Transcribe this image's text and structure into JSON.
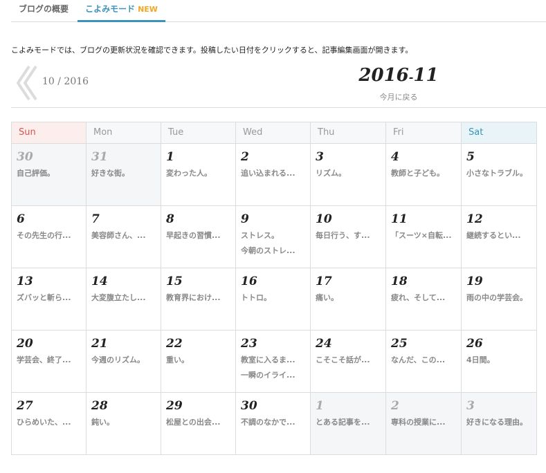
{
  "tabs": {
    "overview": "ブログの概要",
    "calendar": "こよみモード",
    "calendar_badge": "NEW"
  },
  "description": "こよみモードでは、ブログの更新状況を確認できます。投稿したい日付をクリックすると、記事編集画面が開きます。",
  "nav": {
    "prev_label": "10 / 2016",
    "current_year": "2016",
    "current_sep": "-",
    "current_month": "11",
    "back_label": "今月に戻る"
  },
  "weekdays": [
    "Sun",
    "Mon",
    "Tue",
    "Wed",
    "Thu",
    "Fri",
    "Sat"
  ],
  "weeks": [
    [
      {
        "day": "30",
        "other": true,
        "posts": [
          "自己評価。"
        ]
      },
      {
        "day": "31",
        "other": true,
        "posts": [
          "好きな街。"
        ]
      },
      {
        "day": "1",
        "posts": [
          "変わった人。"
        ]
      },
      {
        "day": "2",
        "posts": [
          "追い込まれる..."
        ]
      },
      {
        "day": "3",
        "posts": [
          "リズム。"
        ]
      },
      {
        "day": "4",
        "posts": [
          "教師と子ども。"
        ]
      },
      {
        "day": "5",
        "posts": [
          "小さなトラブル。"
        ]
      }
    ],
    [
      {
        "day": "6",
        "posts": [
          "その先生の行..."
        ]
      },
      {
        "day": "7",
        "posts": [
          "美容師さん、..."
        ]
      },
      {
        "day": "8",
        "posts": [
          "早起きの習慣..."
        ]
      },
      {
        "day": "9",
        "posts": [
          "ストレス。",
          "今朝のストレ..."
        ]
      },
      {
        "day": "10",
        "posts": [
          "毎日行う、す..."
        ]
      },
      {
        "day": "11",
        "posts": [
          "「スーツ×自転..."
        ]
      },
      {
        "day": "12",
        "posts": [
          "継続するとい..."
        ]
      }
    ],
    [
      {
        "day": "13",
        "posts": [
          "ズバッと斬ら..."
        ]
      },
      {
        "day": "14",
        "posts": [
          "大変腹立たし..."
        ]
      },
      {
        "day": "15",
        "posts": [
          "教育界におけ..."
        ]
      },
      {
        "day": "16",
        "posts": [
          "トトロ。"
        ]
      },
      {
        "day": "17",
        "posts": [
          "痛い。"
        ]
      },
      {
        "day": "18",
        "posts": [
          "疲れ、そして..."
        ]
      },
      {
        "day": "19",
        "posts": [
          "雨の中の学芸会。"
        ]
      }
    ],
    [
      {
        "day": "20",
        "posts": [
          "学芸会、終了..."
        ]
      },
      {
        "day": "21",
        "posts": [
          "今週のリズム。"
        ]
      },
      {
        "day": "22",
        "posts": [
          "重い。"
        ]
      },
      {
        "day": "23",
        "posts": [
          "教室に入るま...",
          "一瞬のイライ..."
        ]
      },
      {
        "day": "24",
        "posts": [
          "こそこそ話が..."
        ]
      },
      {
        "day": "25",
        "posts": [
          "なんだ、この..."
        ]
      },
      {
        "day": "26",
        "posts": [
          "4日間。"
        ]
      }
    ],
    [
      {
        "day": "27",
        "posts": [
          "ひらめいた、..."
        ]
      },
      {
        "day": "28",
        "posts": [
          "鈍い。"
        ]
      },
      {
        "day": "29",
        "posts": [
          "松屋との出会..."
        ]
      },
      {
        "day": "30",
        "posts": [
          "不調のなかで..."
        ]
      },
      {
        "day": "1",
        "other": true,
        "posts": [
          "とある記事を..."
        ]
      },
      {
        "day": "2",
        "other": true,
        "posts": [
          "専科の授業に..."
        ]
      },
      {
        "day": "3",
        "other": true,
        "posts": [
          "好きになる理由。"
        ]
      }
    ]
  ]
}
